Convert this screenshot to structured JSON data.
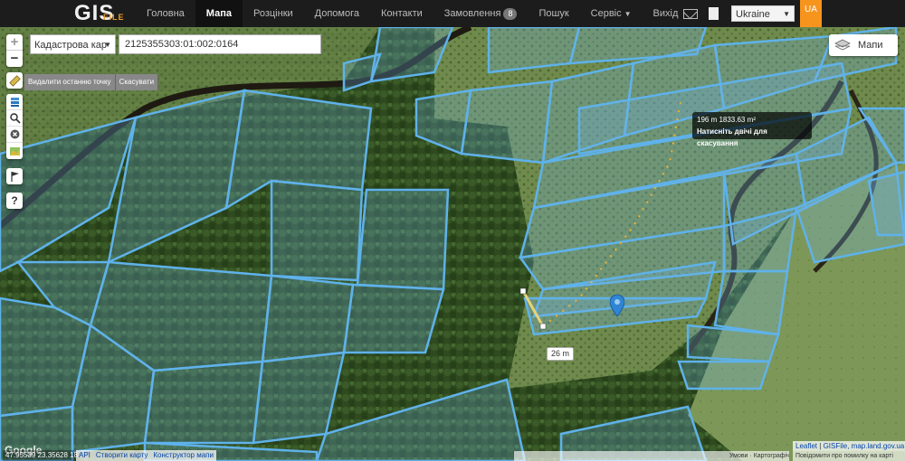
{
  "brand": {
    "logo_main": "GIS",
    "logo_sub": "FILE"
  },
  "nav": {
    "items": [
      {
        "label": "Головна"
      },
      {
        "label": "Мапа",
        "active": true
      },
      {
        "label": "Розцінки"
      },
      {
        "label": "Допомога"
      },
      {
        "label": "Контакти"
      },
      {
        "label": "Замовлення",
        "badge": "8"
      },
      {
        "label": "Пошук"
      },
      {
        "label": "Сервіс"
      },
      {
        "label": "Вихід"
      }
    ]
  },
  "header_right": {
    "country_select": "Ukraine",
    "language": "UA"
  },
  "map_controls": {
    "zoom_in": "+",
    "zoom_out": "−",
    "layer_select": "Кадастрова кар",
    "cadastre_number": "2125355303:01:002:0164",
    "measure_undo": "Видалити останню точку",
    "measure_cancel": "Скасувати",
    "layers_button": "Мапи"
  },
  "measurement": {
    "distance_area": "196 m 1833.63 m²",
    "hint": "Натисніть двічі для скасування",
    "segment_label": "26 m"
  },
  "footer": {
    "coordinates": "47.95539 23.35628 18",
    "google": "Google",
    "links": [
      "API",
      "Створити карту",
      "Конструктор мапи"
    ],
    "map_data": "Умови · Картографічні дані",
    "attribution_leaflet": "Leaflet",
    "attribution_rest": "GISFile, map.land.gov.ua",
    "report": "Повідомити про помилку на карті"
  },
  "colors": {
    "accent": "#f7941d",
    "parcel_stroke": "#5fb2ea",
    "topbar": "#1c1c1c"
  }
}
